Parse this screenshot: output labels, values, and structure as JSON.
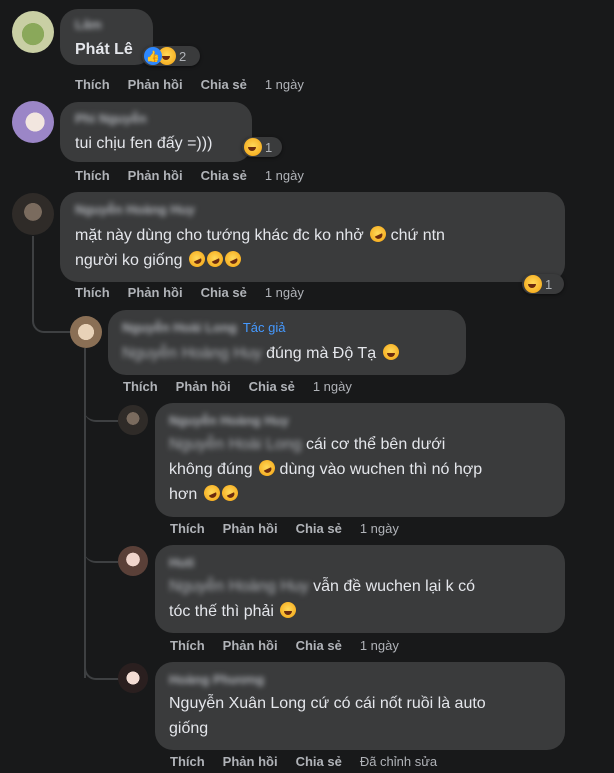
{
  "time_label": "1 ngày",
  "actions": {
    "like": "Thích",
    "reply": "Phản hồi",
    "share": "Chia sẻ"
  },
  "comments": [
    {
      "author_blurred": "Lâm",
      "text": "Phát Lê",
      "reaction_count": "2",
      "time": "1 ngày"
    },
    {
      "author_blurred": "Phi Nguyễn",
      "text": "tui chịu fen đấy =)))",
      "reaction_count": "1",
      "time": "1 ngày"
    },
    {
      "author_blurred": "Nguyễn Hoàng Huy",
      "text_line1": "mặt này dùng cho tướng khác đc ko nhở",
      "text_line1b": "chứ ntn",
      "text_line2": "người ko giống",
      "reaction_count": "1",
      "time": "1 ngày"
    },
    {
      "author_blurred": "Nguyễn Hoài Long",
      "author_tag": "Tác giả",
      "mention_blurred": "Nguyễn Hoàng Huy",
      "text": "đúng mà Độ Tạ",
      "time": "1 ngày"
    },
    {
      "author_blurred": "Nguyễn Hoàng Huy",
      "mention_blurred": "Nguyễn Hoài Long",
      "text_line1": "cái cơ thể bên dưới",
      "text_line2a": "không đúng",
      "text_line2b": "dùng vào wuchen thì nó hợp",
      "text_line3": "hơn",
      "time": "1 ngày"
    },
    {
      "author_blurred": "Huti",
      "mention_blurred": "Nguyễn Hoàng Huy",
      "text_line1": "vẫn đề wuchen lại k có",
      "text_line2": "tóc thế thì phải",
      "time": "1 ngày"
    },
    {
      "author_blurred": "Hoàng Phương",
      "text_line1": "Nguyễn Xuân Long cứ có cái nốt ruồi là auto",
      "text_line2": "giống",
      "time": "Đã chỉnh sửa"
    }
  ]
}
